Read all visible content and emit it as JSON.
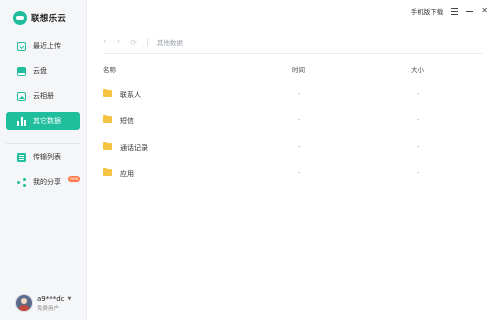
{
  "brand": {
    "name": "联想乐云"
  },
  "sidebar": {
    "items": [
      {
        "label": "最近上传",
        "icon": "recent-upload-icon"
      },
      {
        "label": "云盘",
        "icon": "cloud-disk-icon"
      },
      {
        "label": "云相册",
        "icon": "photo-album-icon"
      },
      {
        "label": "其它数据",
        "icon": "bar-chart-icon",
        "active": true
      },
      {
        "label": "传输列表",
        "icon": "transfer-list-icon"
      },
      {
        "label": "我的分享",
        "icon": "share-icon",
        "badge": "new"
      }
    ]
  },
  "user": {
    "name": "a9***dc",
    "plan": "免费用户"
  },
  "topbar": {
    "download_label": "手机版下载"
  },
  "toolbar": {
    "breadcrumb": "其他数据"
  },
  "table": {
    "headers": {
      "name": "名称",
      "time": "时间",
      "size": "大小"
    },
    "rows": [
      {
        "name": "联系人",
        "time": "-",
        "size": "-"
      },
      {
        "name": "短信",
        "time": "-",
        "size": "-"
      },
      {
        "name": "通话记录",
        "time": "-",
        "size": "-"
      },
      {
        "name": "应用",
        "time": "-",
        "size": "-"
      }
    ]
  },
  "colors": {
    "accent": "#1fbf9e",
    "folder": "#f7c343",
    "badge": "#ff7b4a"
  }
}
